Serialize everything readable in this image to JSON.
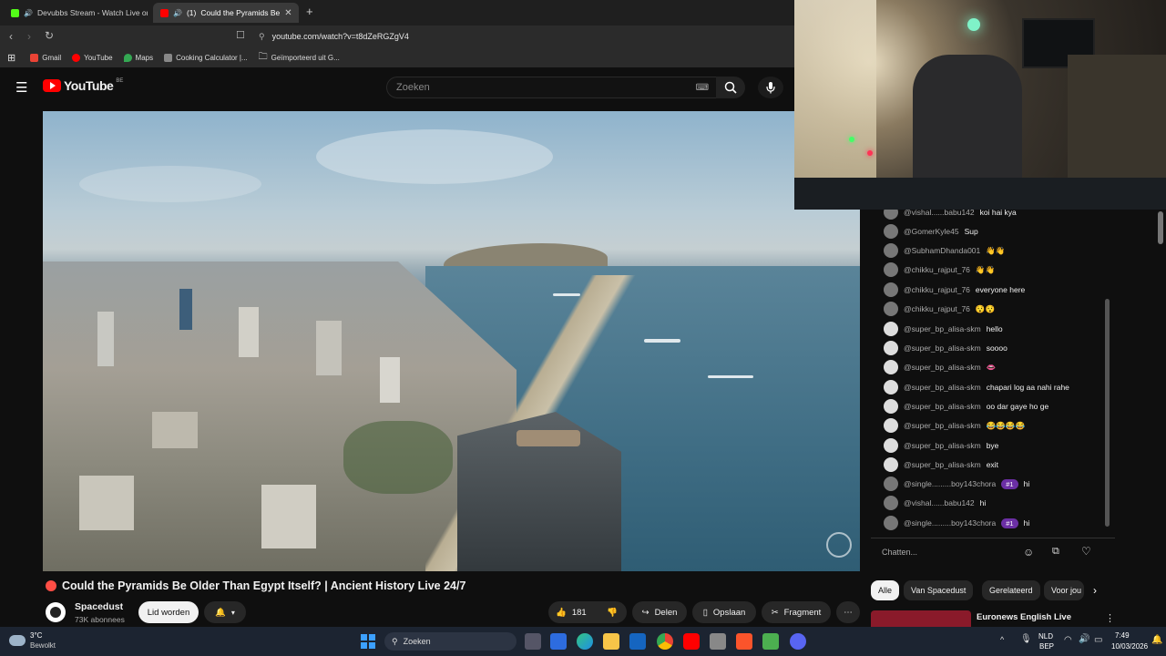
{
  "browser": {
    "tabs": [
      {
        "label": "Devubbs Stream - Watch Live on"
      },
      {
        "label": "(1)",
        "title": "Could the Pyramids Be"
      }
    ],
    "new_tab": "+",
    "url": "youtube.com/watch?v=t8dZeRGZgV4",
    "bookmarks": [
      "Gmail",
      "YouTube",
      "Maps",
      "Cooking Calculator |...",
      "Geïmporteerd uit G..."
    ]
  },
  "youtube": {
    "logo": "YouTube",
    "country": "BE",
    "search_placeholder": "Zoeken"
  },
  "video": {
    "title": "Could the Pyramids Be Older Than Egypt Itself? | Ancient History Live 24/7",
    "channel": "Spacedust",
    "subscribers": "73K abonnees",
    "join_label": "Lid worden",
    "likes": "181",
    "share_label": "Delen",
    "save_label": "Opslaan",
    "clip_label": "Fragment"
  },
  "chat": {
    "messages": [
      {
        "author": "@vishal......babu142",
        "text": "koi hai kya"
      },
      {
        "author": "@GomerKyle45",
        "text": "Sup"
      },
      {
        "author": "@SubhamDhanda001",
        "text": "👋👋"
      },
      {
        "author": "@chikku_rajput_76",
        "text": "👋👋"
      },
      {
        "author": "@chikku_rajput_76",
        "text": "everyone here"
      },
      {
        "author": "@chikku_rajput_76",
        "text": "😯😯"
      },
      {
        "author": "@super_bp_alisa-skm",
        "text": "hello"
      },
      {
        "author": "@super_bp_alisa-skm",
        "text": "soooo"
      },
      {
        "author": "@super_bp_alisa-skm",
        "text": "👄"
      },
      {
        "author": "@super_bp_alisa-skm",
        "text": "chapari log aa nahi rahe"
      },
      {
        "author": "@super_bp_alisa-skm",
        "text": "oo dar gaye ho ge"
      },
      {
        "author": "@super_bp_alisa-skm",
        "text": "😂😂😂😂"
      },
      {
        "author": "@super_bp_alisa-skm",
        "text": "bye"
      },
      {
        "author": "@super_bp_alisa-skm",
        "text": "exit"
      },
      {
        "author": "@single.........boy143chora",
        "badge": "#1",
        "text": "hi"
      },
      {
        "author": "@vishal......babu142",
        "text": "hi"
      },
      {
        "author": "@single.........boy143chora",
        "badge": "#1",
        "text": "hi"
      }
    ],
    "input_placeholder": "Chatten..."
  },
  "chips": [
    "Alle",
    "Van Spacedust",
    "Gerelateerd",
    "Voor jou"
  ],
  "recommended": {
    "title": "Euronews English Live"
  },
  "taskbar": {
    "weather_temp": "3°C",
    "weather_desc": "Bewolkt",
    "search_label": "Zoeken",
    "lang": "NLD",
    "lang2": "BEP",
    "time": "7:49",
    "date": "10/03/2026"
  },
  "colors": {
    "accent": "#ff0000",
    "live": "#ff4e45",
    "badge": "#6b2fa5"
  }
}
